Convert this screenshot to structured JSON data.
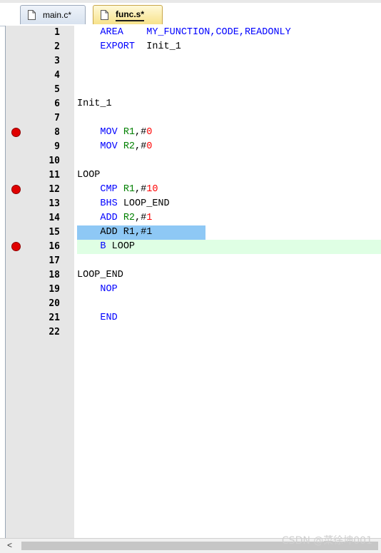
{
  "tabs": [
    {
      "label": "main.c*",
      "active": false
    },
    {
      "label": "func.s*",
      "active": true
    }
  ],
  "lines": [
    {
      "n": "1",
      "bp": false,
      "tokens": [
        {
          "t": "    "
        },
        {
          "t": "AREA",
          "c": "kw"
        },
        {
          "t": "    "
        },
        {
          "t": "MY_FUNCTION,",
          "c": "kw"
        },
        {
          "t": "CODE,",
          "c": "kw"
        },
        {
          "t": "READONLY",
          "c": "kw"
        }
      ]
    },
    {
      "n": "2",
      "bp": false,
      "tokens": [
        {
          "t": "    "
        },
        {
          "t": "EXPORT",
          "c": "kw"
        },
        {
          "t": "  Init_1"
        }
      ]
    },
    {
      "n": "3",
      "bp": false,
      "tokens": []
    },
    {
      "n": "4",
      "bp": false,
      "tokens": []
    },
    {
      "n": "5",
      "bp": false,
      "tokens": []
    },
    {
      "n": "6",
      "bp": false,
      "tokens": [
        {
          "t": "Init_1"
        }
      ]
    },
    {
      "n": "7",
      "bp": false,
      "tokens": []
    },
    {
      "n": "8",
      "bp": true,
      "tokens": [
        {
          "t": "    "
        },
        {
          "t": "MOV",
          "c": "kw"
        },
        {
          "t": " "
        },
        {
          "t": "R1",
          "c": "reg"
        },
        {
          "t": ",#"
        },
        {
          "t": "0",
          "c": "num"
        }
      ]
    },
    {
      "n": "9",
      "bp": false,
      "tokens": [
        {
          "t": "    "
        },
        {
          "t": "MOV",
          "c": "kw"
        },
        {
          "t": " "
        },
        {
          "t": "R2",
          "c": "reg"
        },
        {
          "t": ",#"
        },
        {
          "t": "0",
          "c": "num"
        }
      ]
    },
    {
      "n": "10",
      "bp": false,
      "tokens": []
    },
    {
      "n": "11",
      "bp": false,
      "tokens": [
        {
          "t": "LOOP"
        }
      ]
    },
    {
      "n": "12",
      "bp": true,
      "tokens": [
        {
          "t": "    "
        },
        {
          "t": "CMP",
          "c": "kw"
        },
        {
          "t": " "
        },
        {
          "t": "R1",
          "c": "reg"
        },
        {
          "t": ",#"
        },
        {
          "t": "10",
          "c": "num"
        }
      ]
    },
    {
      "n": "13",
      "bp": false,
      "tokens": [
        {
          "t": "    "
        },
        {
          "t": "BHS",
          "c": "kw"
        },
        {
          "t": " LOOP_END"
        }
      ]
    },
    {
      "n": "14",
      "bp": false,
      "tokens": [
        {
          "t": "    "
        },
        {
          "t": "ADD",
          "c": "kw"
        },
        {
          "t": " "
        },
        {
          "t": "R2",
          "c": "reg"
        },
        {
          "t": ",#"
        },
        {
          "t": "1",
          "c": "num"
        }
      ]
    },
    {
      "n": "15",
      "bp": false,
      "selected": true,
      "tokens": [
        {
          "t": "    ADD R1,#1"
        }
      ]
    },
    {
      "n": "16",
      "bp": true,
      "current": true,
      "tokens": [
        {
          "t": "    "
        },
        {
          "t": "B",
          "c": "kw"
        },
        {
          "t": " LOOP"
        }
      ]
    },
    {
      "n": "17",
      "bp": false,
      "tokens": []
    },
    {
      "n": "18",
      "bp": false,
      "tokens": [
        {
          "t": "LOOP_END"
        }
      ]
    },
    {
      "n": "19",
      "bp": false,
      "tokens": [
        {
          "t": "    "
        },
        {
          "t": "NOP",
          "c": "kw"
        }
      ]
    },
    {
      "n": "20",
      "bp": false,
      "tokens": []
    },
    {
      "n": "21",
      "bp": false,
      "tokens": [
        {
          "t": "    "
        },
        {
          "t": "END",
          "c": "kw"
        }
      ]
    },
    {
      "n": "22",
      "bp": false,
      "tokens": []
    }
  ],
  "scrollbar": {
    "left_arrow": "<"
  },
  "watermark": "CSDN @菜徐坤001",
  "colors": {
    "keyword": "#0000ff",
    "register": "#008000",
    "number": "#ff0000",
    "breakpoint": "#e00000",
    "current_line": "#dfffe4",
    "selection": "#8ec8f5"
  }
}
